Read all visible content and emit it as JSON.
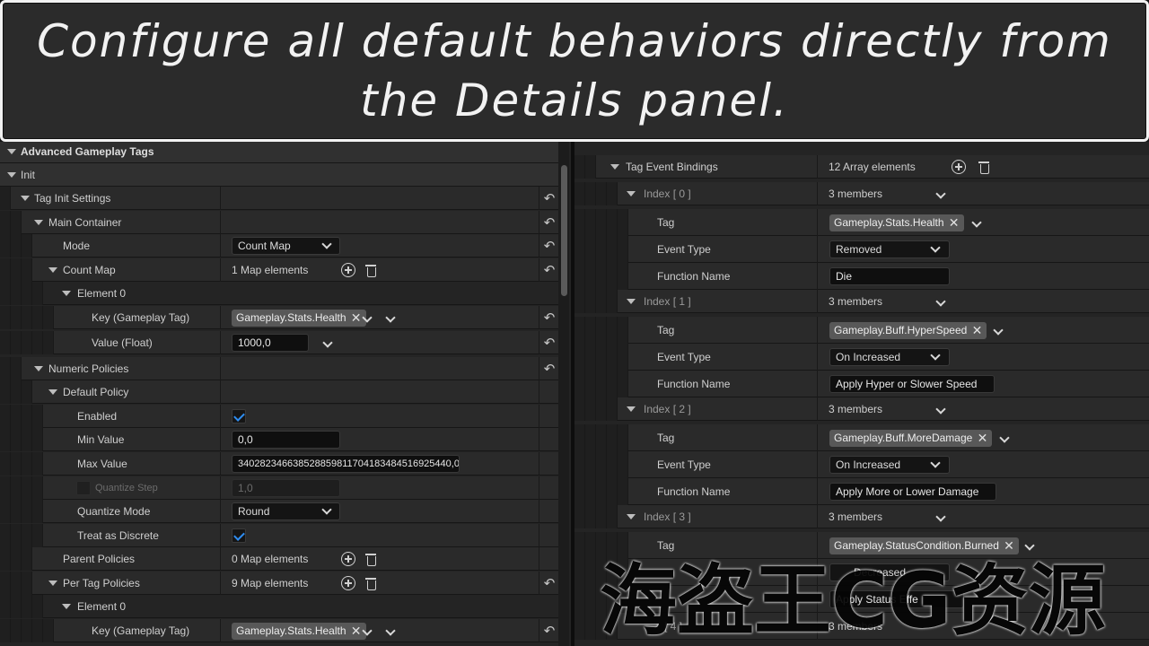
{
  "banner": {
    "line1": "Configure all default behaviors directly from",
    "line2": "the Details panel."
  },
  "left": {
    "category": "Advanced Gameplay Tags",
    "init": "Init",
    "tag_init_settings": "Tag Init Settings",
    "main_container": "Main Container",
    "mode_label": "Mode",
    "mode_value": "Count Map",
    "count_map_label": "Count Map",
    "count_map_value": "1 Map elements",
    "element0": "Element 0",
    "key_label": "Key (Gameplay Tag)",
    "key_value": "Gameplay.Stats.Health",
    "value_label": "Value (Float)",
    "value_value": "1000,0",
    "numeric_policies": "Numeric Policies",
    "default_policy": "Default Policy",
    "enabled_label": "Enabled",
    "enabled_checked": true,
    "min_label": "Min Value",
    "min_value": "0,0",
    "max_label": "Max Value",
    "max_value": "340282346638528859811704183484516925440,0",
    "quantize_step_label": "Quantize Step",
    "quantize_step_value": "1,0",
    "quantize_mode_label": "Quantize Mode",
    "quantize_mode_value": "Round",
    "treat_discrete_label": "Treat as Discrete",
    "treat_discrete_checked": true,
    "parent_policies_label": "Parent Policies",
    "parent_policies_value": "0 Map elements",
    "per_tag_policies_label": "Per Tag Policies",
    "per_tag_policies_value": "9 Map elements",
    "element0_b": "Element 0",
    "key_label_b": "Key (Gameplay Tag)",
    "key_value_b": "Gameplay.Stats.Health"
  },
  "right": {
    "bindings_label": "Tag Event Bindings",
    "bindings_value": "12 Array elements",
    "index0": "Index [ 0 ]",
    "index0_members": "3 members",
    "tag_label": "Tag",
    "event_type_label": "Event Type",
    "function_name_label": "Function Name",
    "tag0": "Gameplay.Stats.Health",
    "event0": "Removed",
    "func0": "Die",
    "index1": "Index [ 1 ]",
    "index1_members": "3 members",
    "tag1": "Gameplay.Buff.HyperSpeed",
    "event1": "On Increased",
    "func1": "Apply Hyper or Slower Speed",
    "index2": "Index [ 2 ]",
    "index2_members": "3 members",
    "tag2": "Gameplay.Buff.MoreDamage",
    "event2": "On Increased",
    "func2": "Apply More or Lower Damage",
    "index3": "Index [ 3 ]",
    "index3_members": "3 members",
    "tag3": "Gameplay.StatusCondition.Burned",
    "event3_partial": "Decreased",
    "func3_partial": "Apply Status Effe",
    "index4_partial": "[ 4 ]",
    "index4_members_partial": "3 members"
  },
  "watermark": "海盗王CG资源",
  "icons": {
    "reset": "reset-arrow-icon",
    "add": "plus-circle-icon",
    "delete": "trash-icon",
    "expand": "expand-arrow-icon",
    "remove": "close-icon"
  }
}
